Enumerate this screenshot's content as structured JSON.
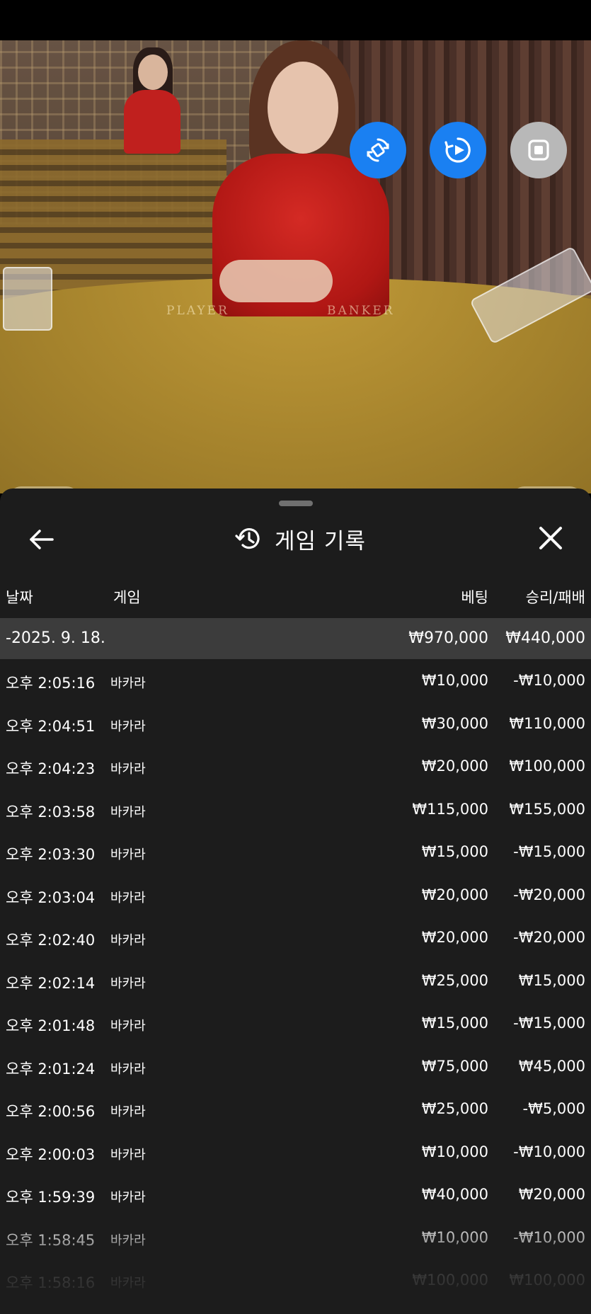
{
  "video": {
    "table_labels": {
      "player": "PLAYER",
      "banker": "BANKER"
    },
    "side_tab_left": "9",
    "side_tab_right": "9",
    "controls": [
      {
        "name": "rotate-screen-button",
        "icon": "screen-rotate-icon",
        "color": "#1a80f2"
      },
      {
        "name": "replay-button",
        "icon": "replay-play-icon",
        "color": "#1a80f2"
      },
      {
        "name": "stop-button",
        "icon": "stop-square-icon",
        "color": "#b8b8b8"
      }
    ]
  },
  "sheet": {
    "title": "게임 기록",
    "title_icon": "history-icon",
    "back_icon": "arrow-left-icon",
    "close_icon": "close-icon",
    "columns": {
      "date": "날짜",
      "game": "게임",
      "bet": "베팅",
      "win_loss": "승리/패배"
    },
    "date_group": {
      "date": "-2025. 9. 18.",
      "bet_total": "₩970,000",
      "win_total": "₩440,000"
    },
    "rows": [
      {
        "time": "오후 2:05:16",
        "game": "바카라",
        "bet": "₩10,000",
        "result": "-₩10,000"
      },
      {
        "time": "오후 2:04:51",
        "game": "바카라",
        "bet": "₩30,000",
        "result": "₩110,000"
      },
      {
        "time": "오후 2:04:23",
        "game": "바카라",
        "bet": "₩20,000",
        "result": "₩100,000"
      },
      {
        "time": "오후 2:03:58",
        "game": "바카라",
        "bet": "₩115,000",
        "result": "₩155,000"
      },
      {
        "time": "오후 2:03:30",
        "game": "바카라",
        "bet": "₩15,000",
        "result": "-₩15,000"
      },
      {
        "time": "오후 2:03:04",
        "game": "바카라",
        "bet": "₩20,000",
        "result": "-₩20,000"
      },
      {
        "time": "오후 2:02:40",
        "game": "바카라",
        "bet": "₩20,000",
        "result": "-₩20,000"
      },
      {
        "time": "오후 2:02:14",
        "game": "바카라",
        "bet": "₩25,000",
        "result": "₩15,000"
      },
      {
        "time": "오후 2:01:48",
        "game": "바카라",
        "bet": "₩15,000",
        "result": "-₩15,000"
      },
      {
        "time": "오후 2:01:24",
        "game": "바카라",
        "bet": "₩75,000",
        "result": "₩45,000"
      },
      {
        "time": "오후 2:00:56",
        "game": "바카라",
        "bet": "₩25,000",
        "result": "-₩5,000"
      },
      {
        "time": "오후 2:00:03",
        "game": "바카라",
        "bet": "₩10,000",
        "result": "-₩10,000"
      },
      {
        "time": "오후 1:59:39",
        "game": "바카라",
        "bet": "₩40,000",
        "result": "₩20,000"
      },
      {
        "time": "오후 1:58:45",
        "game": "바카라",
        "bet": "₩10,000",
        "result": "-₩10,000"
      },
      {
        "time": "오후 1:58:16",
        "game": "바카라",
        "bet": "₩100,000",
        "result": "₩100,000"
      }
    ]
  }
}
